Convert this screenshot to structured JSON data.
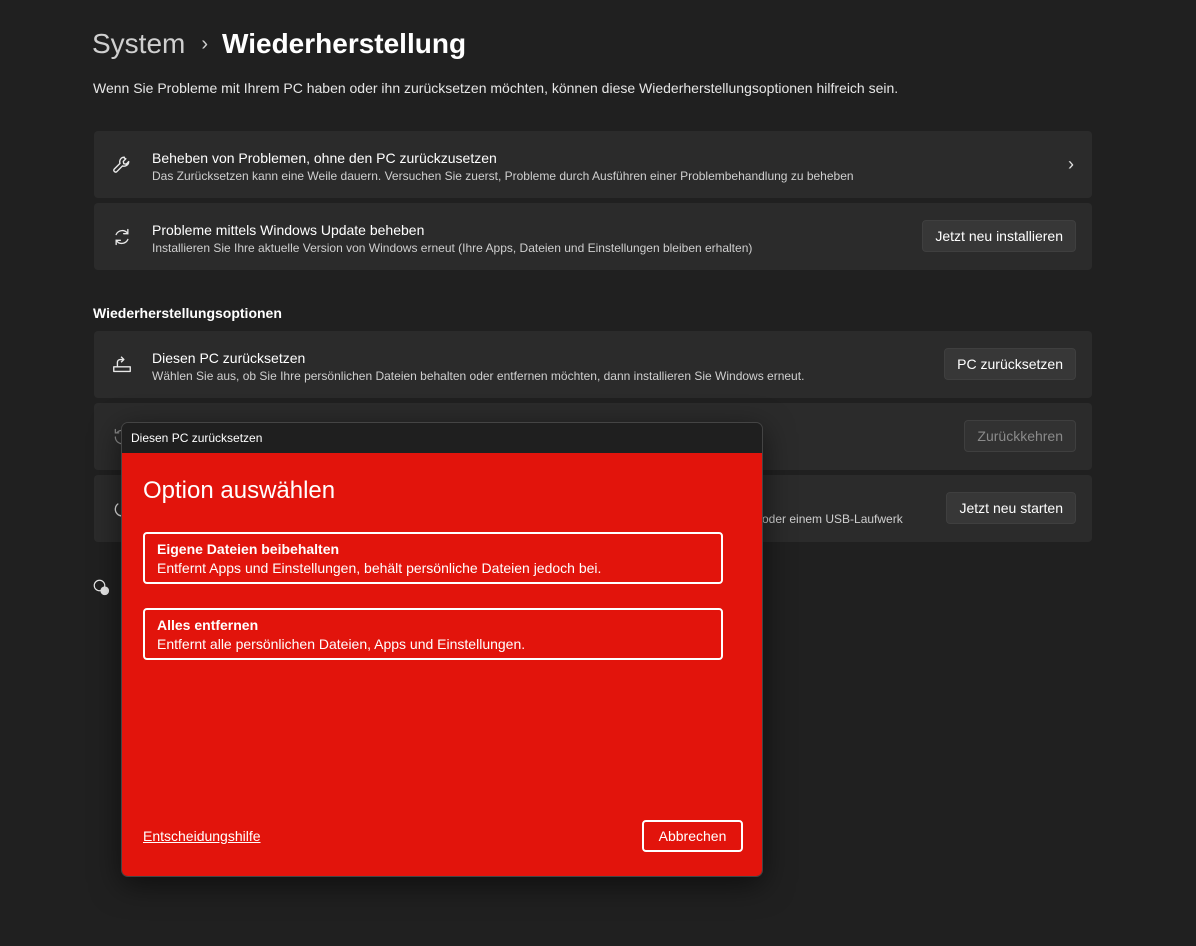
{
  "breadcrumb": {
    "parent": "System",
    "separator": "›",
    "current": "Wiederherstellung"
  },
  "intro": "Wenn Sie Probleme mit Ihrem PC haben oder ihn zurücksetzen möchten, können diese Wiederherstellungsoptionen hilfreich sein.",
  "cards_top": [
    {
      "icon": "wrench-icon",
      "title": "Beheben von Problemen, ohne den PC zurückzusetzen",
      "desc": "Das Zurücksetzen kann eine Weile dauern. Versuchen Sie zuerst, Probleme durch Ausführen einer Problembehandlung zu beheben"
    },
    {
      "icon": "sync-icon",
      "title": "Probleme mittels Windows Update beheben",
      "desc": "Installieren Sie Ihre aktuelle Version von Windows erneut (Ihre Apps, Dateien und Einstellungen bleiben erhalten)",
      "button": "Jetzt neu installieren"
    }
  ],
  "section_title": "Wiederherstellungsoptionen",
  "cards_recovery": [
    {
      "icon": "reset-pc-icon",
      "title": "Diesen PC zurücksetzen",
      "desc": "Wählen Sie aus, ob Sie Ihre persönlichen Dateien behalten oder entfernen möchten, dann installieren Sie Windows erneut.",
      "button": "PC zurücksetzen"
    },
    {
      "icon": "history-icon",
      "button": "Zurückkehren",
      "disabled": true
    },
    {
      "icon": "power-icon",
      "desc_partial": "oder einem USB-Laufwerk",
      "button": "Jetzt neu starten"
    }
  ],
  "dialog": {
    "window_title": "Diesen PC zurücksetzen",
    "heading": "Option auswählen",
    "options": [
      {
        "title": "Eigene Dateien beibehalten",
        "desc": "Entfernt Apps und Einstellungen, behält persönliche Dateien jedoch bei."
      },
      {
        "title": "Alles entfernen",
        "desc": "Entfernt alle persönlichen Dateien, Apps und Einstellungen."
      }
    ],
    "help_link": "Entscheidungshilfe",
    "cancel": "Abbrechen",
    "background_color": "#e2140c"
  }
}
